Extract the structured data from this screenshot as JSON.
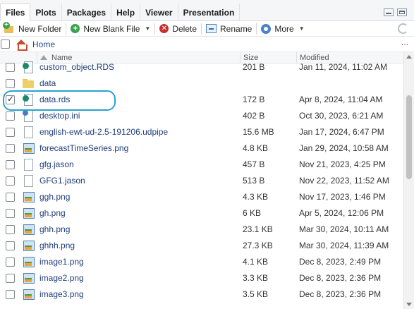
{
  "tabs": [
    {
      "label": "Files",
      "active": true
    },
    {
      "label": "Plots",
      "active": false
    },
    {
      "label": "Packages",
      "active": false
    },
    {
      "label": "Help",
      "active": false
    },
    {
      "label": "Viewer",
      "active": false
    },
    {
      "label": "Presentation",
      "active": false
    }
  ],
  "toolbar": {
    "new_folder": "New Folder",
    "new_blank_file": "New Blank File",
    "delete": "Delete",
    "rename": "Rename",
    "more": "More"
  },
  "path": {
    "home": "Home",
    "more": "..."
  },
  "columns": {
    "name": "Name",
    "size": "Size",
    "modified": "Modified"
  },
  "files": [
    {
      "name": "custom_object.RDS",
      "size": "201 B",
      "modified": "Jan 11, 2024, 11:02 AM",
      "icon": "rds-icon",
      "checked": false
    },
    {
      "name": "data",
      "size": "",
      "modified": "",
      "icon": "folder-icon",
      "checked": false
    },
    {
      "name": "data.rds",
      "size": "172 B",
      "modified": "Apr 8, 2024, 11:04 AM",
      "icon": "rds-icon",
      "checked": true
    },
    {
      "name": "desktop.ini",
      "size": "402 B",
      "modified": "Oct 30, 2023, 6:21 AM",
      "icon": "settings-file-icon",
      "checked": false
    },
    {
      "name": "english-ewt-ud-2.5-191206.udpipe",
      "size": "15.6 MB",
      "modified": "Jan 17, 2024, 6:47 PM",
      "icon": "document-icon",
      "checked": false
    },
    {
      "name": "forecastTimeSeries.png",
      "size": "4.8 KB",
      "modified": "Jan 29, 2024, 10:58 AM",
      "icon": "image-icon",
      "checked": false
    },
    {
      "name": "gfg.jason",
      "size": "457 B",
      "modified": "Nov 21, 2023, 4:25 PM",
      "icon": "document-icon",
      "checked": false
    },
    {
      "name": "GFG1.jason",
      "size": "513 B",
      "modified": "Nov 22, 2023, 11:52 AM",
      "icon": "document-icon",
      "checked": false
    },
    {
      "name": "ggh.png",
      "size": "4.3 KB",
      "modified": "Nov 17, 2023, 1:46 PM",
      "icon": "image-icon",
      "checked": false
    },
    {
      "name": "gh.png",
      "size": "6 KB",
      "modified": "Apr 5, 2024, 12:06 PM",
      "icon": "image-icon",
      "checked": false
    },
    {
      "name": "ghh.png",
      "size": "23.1 KB",
      "modified": "Mar 30, 2024, 10:11 AM",
      "icon": "image-icon",
      "checked": false
    },
    {
      "name": "ghhh.png",
      "size": "27.3 KB",
      "modified": "Mar 30, 2024, 11:39 AM",
      "icon": "image-icon",
      "checked": false
    },
    {
      "name": "image1.png",
      "size": "4.1 KB",
      "modified": "Dec 8, 2023, 2:49 PM",
      "icon": "image-icon",
      "checked": false
    },
    {
      "name": "image2.png",
      "size": "3.3 KB",
      "modified": "Dec 8, 2023, 2:36 PM",
      "icon": "image-icon",
      "checked": false
    },
    {
      "name": "image3.png",
      "size": "3.5 KB",
      "modified": "Dec 8, 2023, 2:36 PM",
      "icon": "image-icon",
      "checked": false
    }
  ],
  "scroll": {
    "position_fraction": 0.22,
    "visible_fraction": 0.35
  }
}
